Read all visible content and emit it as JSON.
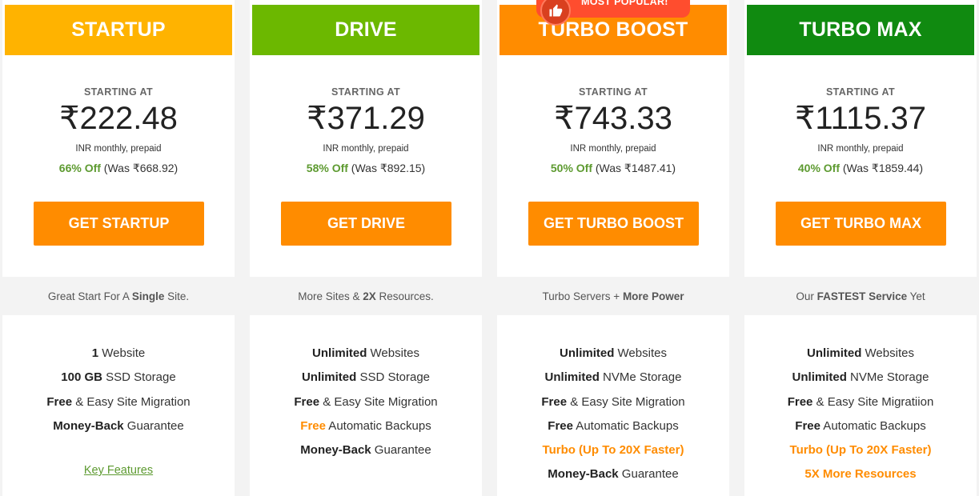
{
  "ribbon": {
    "label": "MOST POPULAR!",
    "icon": "thumbs-up-icon"
  },
  "colors": {
    "startup": "#ffb300",
    "drive": "#6cb800",
    "turbo_boost": "#ff8c00",
    "turbo_max": "#108a10",
    "cta": "#ff8c00",
    "discount": "#5d9a30"
  },
  "plans": [
    {
      "name": "STARTUP",
      "starting_at": "STARTING AT",
      "price": "₹222.48",
      "billing": "INR monthly, prepaid",
      "discount": "66% Off",
      "was": "(Was ₹668.92)",
      "cta": "GET STARTUP",
      "tagline": {
        "pre": "Great Start For A ",
        "bold": "Single",
        "post": " Site."
      },
      "features": [
        {
          "bold": "1",
          "text": " Website"
        },
        {
          "bold": "100 GB",
          "text": " SSD Storage"
        },
        {
          "bold": "Free",
          "text": " & Easy Site Migration"
        },
        {
          "bold": "Money-Back",
          "text": " Guarantee"
        }
      ],
      "link": "Key Features"
    },
    {
      "name": "DRIVE",
      "starting_at": "STARTING AT",
      "price": "₹371.29",
      "billing": "INR monthly, prepaid",
      "discount": "58% Off",
      "was": "(Was ₹892.15)",
      "cta": "GET DRIVE",
      "tagline": {
        "pre": "More Sites & ",
        "bold": "2X",
        "post": " Resources."
      },
      "features": [
        {
          "bold": "Unlimited",
          "text": " Websites"
        },
        {
          "bold": "Unlimited",
          "text": " SSD Storage"
        },
        {
          "bold": "Free",
          "text": " & Easy Site Migration"
        },
        {
          "bold": "Free",
          "text": " Automatic Backups"
        },
        {
          "bold": "Money-Back",
          "text": " Guarantee"
        }
      ]
    },
    {
      "name": "TURBO BOOST",
      "starting_at": "STARTING AT",
      "price": "₹743.33",
      "billing": "INR monthly, prepaid",
      "discount": "50% Off",
      "was": "(Was ₹1487.41)",
      "cta": "GET TURBO BOOST",
      "tagline": {
        "pre": "Turbo Servers + ",
        "bold": "More Power",
        "post": ""
      },
      "features": [
        {
          "bold": "Unlimited",
          "text": " Websites"
        },
        {
          "bold": "Unlimited",
          "text": " NVMe Storage"
        },
        {
          "bold": "Free",
          "text": " & Easy Site Migration"
        },
        {
          "bold": "Free",
          "text": " Automatic Backups"
        },
        {
          "bold": "Turbo (Up To 20X Faster)",
          "text": ""
        },
        {
          "bold": "Money-Back",
          "text": " Guarantee"
        }
      ]
    },
    {
      "name": "TURBO MAX",
      "starting_at": "STARTING AT",
      "price": "₹1115.37",
      "billing": "INR monthly, prepaid",
      "discount": "40% Off",
      "was": "(Was ₹1859.44)",
      "cta": "GET TURBO MAX",
      "tagline": {
        "pre": "Our ",
        "bold": "FASTEST Service",
        "post": " Yet"
      },
      "features": [
        {
          "bold": "Unlimited",
          "text": " Websites"
        },
        {
          "bold": "Unlimited",
          "text": " NVMe Storage"
        },
        {
          "bold": "Free",
          "text": " & Easy Site Migratiion"
        },
        {
          "bold": "Free",
          "text": " Automatic Backups"
        },
        {
          "bold": "Turbo (Up To 20X Faster)",
          "text": ""
        },
        {
          "bold": "5X More Resources",
          "text": ""
        }
      ]
    }
  ]
}
